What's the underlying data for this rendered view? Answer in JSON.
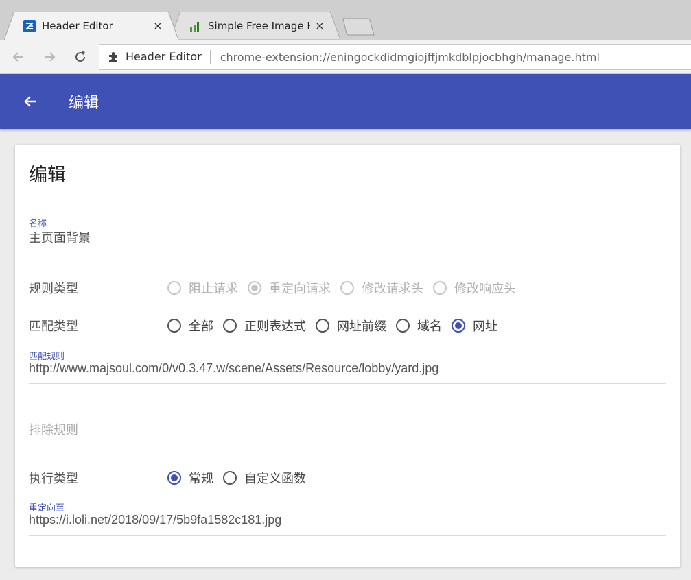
{
  "browser": {
    "tabs": [
      {
        "title": "Header Editor",
        "close": "×"
      },
      {
        "title": "Simple Free Image Hosting",
        "close": "×"
      }
    ],
    "omnibox": {
      "extension_name": "Header Editor",
      "url": "chrome-extension://eningockdidmgiojffjmkdblpjocbhgh/manage.html"
    },
    "icons": {
      "back": "arrow-left-icon",
      "forward": "arrow-right-icon",
      "reload": "reload-icon",
      "extension": "puzzle-piece-icon"
    }
  },
  "appbar": {
    "title": "编辑",
    "color": "#3f51b5"
  },
  "card": {
    "title": "编辑",
    "name_field": {
      "label": "名称",
      "value": "主页面背景"
    },
    "rule_type": {
      "label": "规则类型",
      "options": [
        "阻止请求",
        "重定向请求",
        "修改请求头",
        "修改响应头"
      ],
      "selected_index": 1,
      "disabled": true
    },
    "match_type": {
      "label": "匹配类型",
      "options": [
        "全部",
        "正则表达式",
        "网址前缀",
        "域名",
        "网址"
      ],
      "selected_index": 4
    },
    "match_rule": {
      "label": "匹配规则",
      "value": "http://www.majsoul.com/0/v0.3.47.w/scene/Assets/Resource/lobby/yard.jpg"
    },
    "exclude_rule": {
      "placeholder": "排除规则"
    },
    "exec_type": {
      "label": "执行类型",
      "options": [
        "常规",
        "自定义函数"
      ],
      "selected_index": 0
    },
    "redirect_to": {
      "label": "重定向至",
      "value": "https://i.loli.net/2018/09/17/5b9fa1582c181.jpg"
    }
  }
}
